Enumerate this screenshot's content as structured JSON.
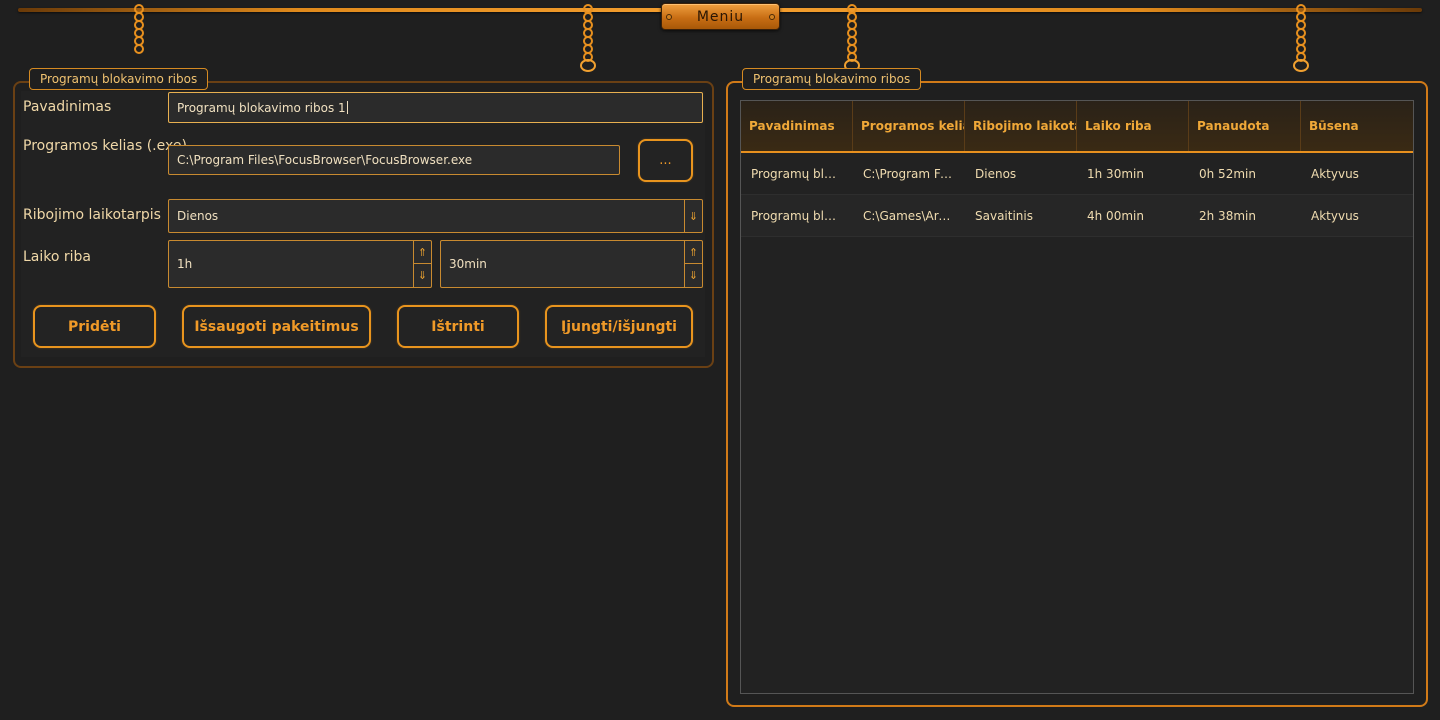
{
  "menu": {
    "label": "Meniu"
  },
  "left_panel": {
    "title": "Programų blokavimo ribos",
    "fields": {
      "name": {
        "label": "Pavadinimas",
        "value": "Programų blokavimo ribos 1"
      },
      "path": {
        "label": "Programos kelias (.exe)",
        "value": "C:\\Program Files\\FocusBrowser\\FocusBrowser.exe",
        "browse_label": "..."
      },
      "period": {
        "label": "Ribojimo laikotarpis",
        "value": "Dienos"
      },
      "limit": {
        "label": "Laiko riba",
        "hours": "1h",
        "minutes": "30min"
      }
    },
    "buttons": {
      "add": "Pridėti",
      "save": "Išsaugoti pakeitimus",
      "delete": "Ištrinti",
      "toggle": "Įjungti/išjungti"
    }
  },
  "right_panel": {
    "title": "Programų blokavimo ribos",
    "columns": [
      "Pavadinimas",
      "Programos kelias (",
      "Ribojimo laikotarp",
      "Laiko riba",
      "Panaudota",
      "Būsena"
    ],
    "rows": [
      [
        "Programų blok...",
        "C:\\Program File...",
        "Dienos",
        "1h 30min",
        "0h 52min",
        "Aktyvus"
      ],
      [
        "Programų blok...",
        "C:\\Games\\Arca...",
        "Savaitinis",
        "4h 00min",
        "2h 38min",
        "Aktyvus"
      ]
    ]
  },
  "colors": {
    "accent": "#e8941e",
    "background": "#1f1f1f",
    "text": "#f0d8a8"
  }
}
